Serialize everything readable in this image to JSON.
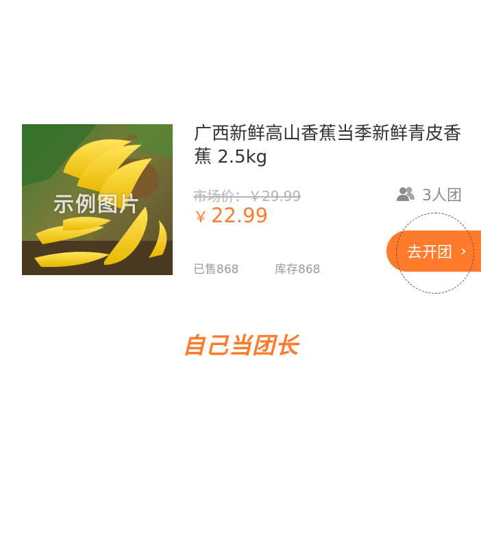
{
  "product": {
    "image_watermark": "示例图片",
    "title": "广西新鲜高山香蕉当季新鲜青皮香蕉 2.5kg",
    "market_price_label": "市场价：￥29.99",
    "currency_symbol": "￥",
    "price": "22.99",
    "group_size": "3人团",
    "sold": "已售868",
    "stock": "库存868"
  },
  "actions": {
    "open_group_label": "去开团",
    "open_group_chevron": "›",
    "self_leader_label": "自己当团长"
  },
  "colors": {
    "accent": "#ff7a2a",
    "title_text": "#333333",
    "muted_text": "#9a9a9a"
  },
  "icons": {
    "group": "people-icon",
    "chevron": "chevron-right-icon"
  }
}
